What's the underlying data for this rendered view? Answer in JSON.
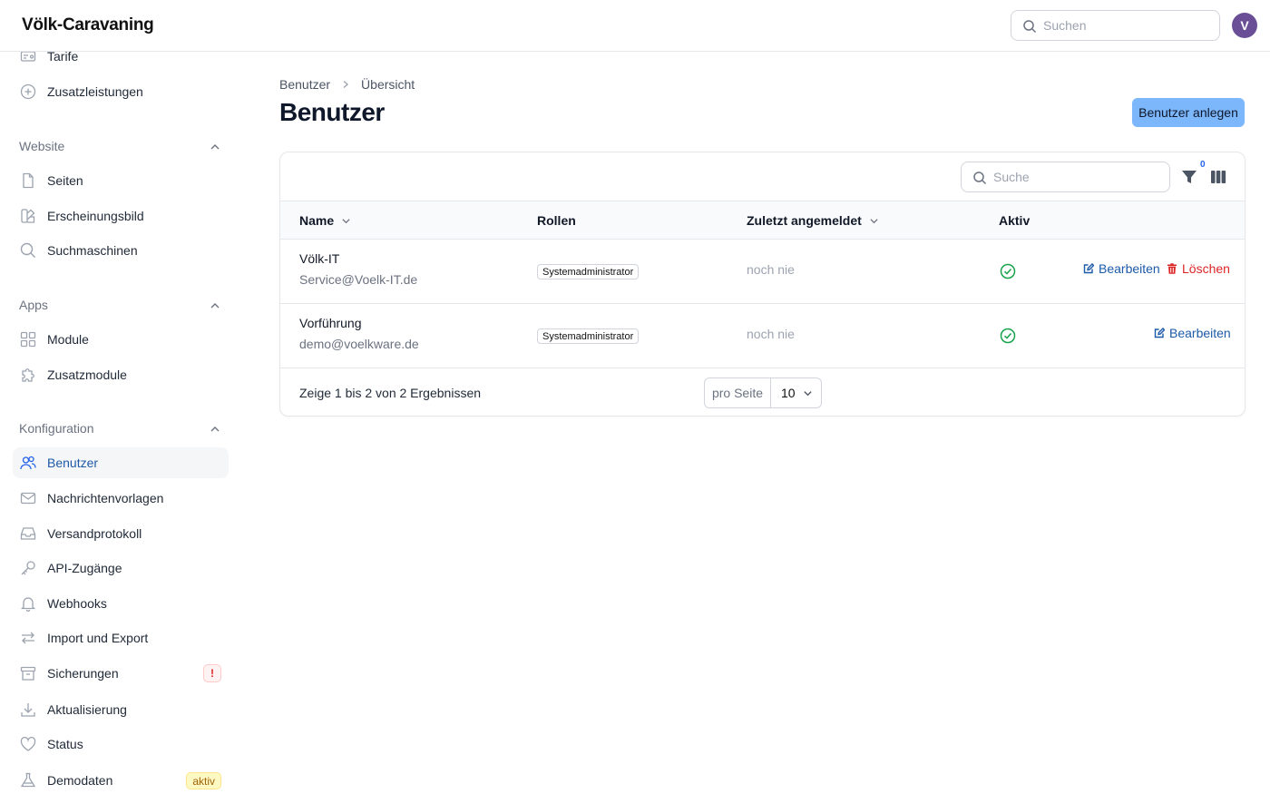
{
  "header": {
    "brand": "Völk-Caravaning",
    "search_placeholder": "Suchen",
    "avatar_initial": "V"
  },
  "sidebar": {
    "items_top": [
      {
        "label": "Tarife",
        "icon": "tariff-icon"
      },
      {
        "label": "Zusatzleistungen",
        "icon": "plus-circle-icon"
      }
    ],
    "sections": [
      {
        "title": "Website",
        "items": [
          {
            "label": "Seiten",
            "icon": "page-icon"
          },
          {
            "label": "Erscheinungsbild",
            "icon": "palette-icon"
          },
          {
            "label": "Suchmaschinen",
            "icon": "search-icon"
          }
        ]
      },
      {
        "title": "Apps",
        "items": [
          {
            "label": "Module",
            "icon": "grid-icon"
          },
          {
            "label": "Zusatzmodule",
            "icon": "puzzle-icon"
          }
        ]
      },
      {
        "title": "Konfiguration",
        "items": [
          {
            "label": "Benutzer",
            "icon": "users-icon",
            "active": true
          },
          {
            "label": "Nachrichtenvorlagen",
            "icon": "envelope-icon"
          },
          {
            "label": "Versandprotokoll",
            "icon": "inbox-icon"
          },
          {
            "label": "API-Zugänge",
            "icon": "key-icon"
          },
          {
            "label": "Webhooks",
            "icon": "bell-icon"
          },
          {
            "label": "Import und Export",
            "icon": "arrows-icon"
          },
          {
            "label": "Sicherungen",
            "icon": "archive-icon",
            "badge": "!"
          },
          {
            "label": "Aktualisierung",
            "icon": "download-icon"
          },
          {
            "label": "Status",
            "icon": "heart-icon"
          },
          {
            "label": "Demodaten",
            "icon": "flask-icon",
            "badge": "aktiv"
          }
        ]
      }
    ]
  },
  "breadcrumb": {
    "first": "Benutzer",
    "second": "Übersicht"
  },
  "page": {
    "title": "Benutzer",
    "create_button": "Benutzer anlegen"
  },
  "table": {
    "search_placeholder": "Suche",
    "filter_count": "0",
    "columns": {
      "name": "Name",
      "roles": "Rollen",
      "last_login": "Zuletzt angemeldet",
      "active": "Aktiv"
    },
    "rows": [
      {
        "name": "Völk-IT",
        "email": "Service@Voelk-IT.de",
        "role": "Systemadministrator",
        "last_login": "noch nie",
        "edit": "Bearbeiten",
        "delete": "Löschen"
      },
      {
        "name": "Vorführung",
        "email": "demo@voelkware.de",
        "role": "Systemadministrator",
        "last_login": "noch nie",
        "edit": "Bearbeiten"
      }
    ],
    "footer": {
      "summary": "Zeige 1 bis 2 von 2 Ergebnissen",
      "per_page_label": "pro Seite",
      "per_page_value": "10"
    }
  },
  "colors": {
    "primary": "#7cb6fb",
    "active_nav": "#1e5aa8",
    "danger": "#dc2626",
    "success": "#16a34a"
  }
}
